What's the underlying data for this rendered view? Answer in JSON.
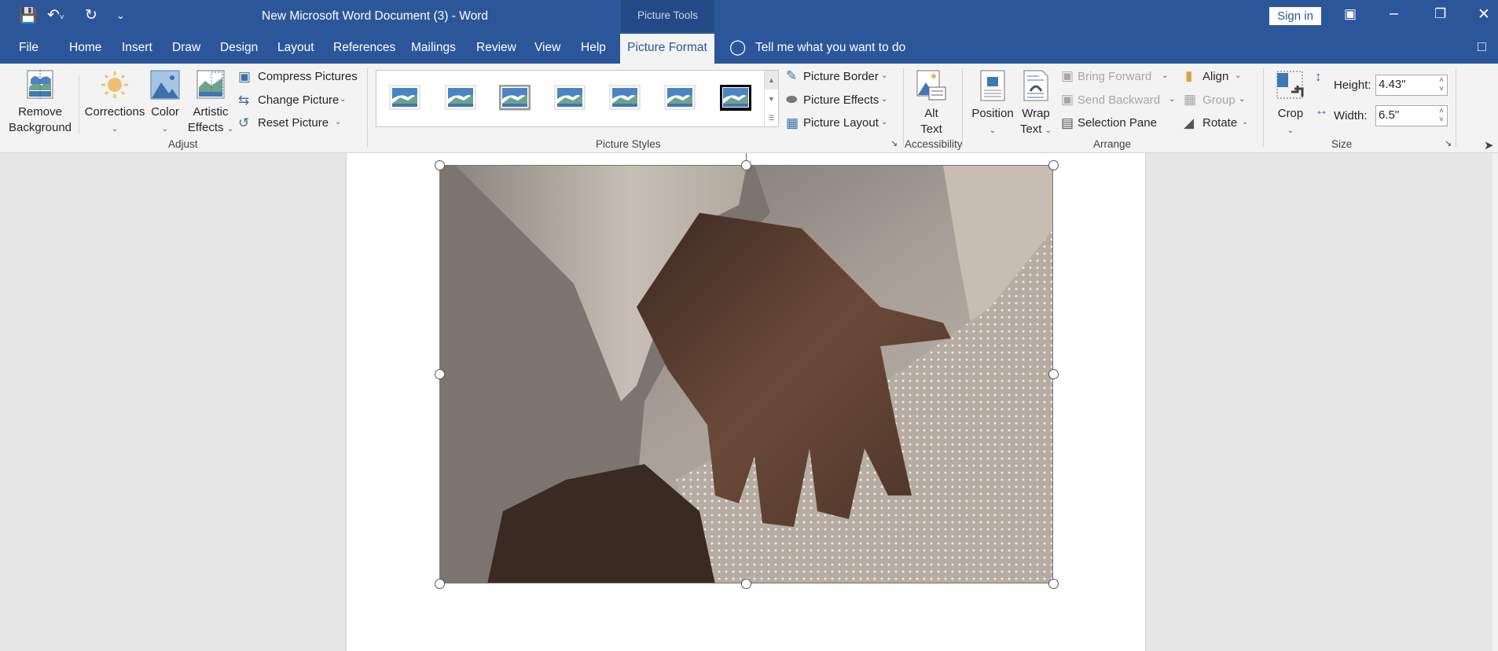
{
  "window": {
    "title": "New Microsoft Word Document (3)  -  Word",
    "context_tab": "Picture Tools",
    "sign_in": "Sign in"
  },
  "tabs": [
    "File",
    "Home",
    "Insert",
    "Draw",
    "Design",
    "Layout",
    "References",
    "Mailings",
    "Review",
    "View",
    "Help",
    "Picture Format"
  ],
  "active_tab": "Picture Format",
  "tell_me": "Tell me what you want to do",
  "ribbon": {
    "adjust": {
      "label": "Adjust",
      "remove_bg": [
        "Remove",
        "Background"
      ],
      "corrections": "Corrections",
      "color": "Color",
      "artistic": [
        "Artistic",
        "Effects"
      ],
      "compress": "Compress Pictures",
      "change": "Change Picture",
      "reset": "Reset Picture"
    },
    "styles": {
      "label": "Picture Styles",
      "border": "Picture Border",
      "effects": "Picture Effects",
      "layout": "Picture Layout"
    },
    "accessibility": {
      "label": "Accessibility",
      "alt_text": [
        "Alt",
        "Text"
      ]
    },
    "arrange": {
      "label": "Arrange",
      "position": "Position",
      "wrap": [
        "Wrap",
        "Text"
      ],
      "bring_forward": "Bring Forward",
      "send_backward": "Send Backward",
      "selection_pane": "Selection Pane",
      "align": "Align",
      "group": "Group",
      "rotate": "Rotate"
    },
    "size": {
      "label": "Size",
      "crop": "Crop",
      "height_label": "Height:",
      "height_value": "4.43\"",
      "width_label": "Width:",
      "width_value": "6.5\""
    }
  },
  "colors": {
    "brand": "#2b579a",
    "ribbon": "#f3f3f3",
    "canvas": "#e6e6e6"
  }
}
